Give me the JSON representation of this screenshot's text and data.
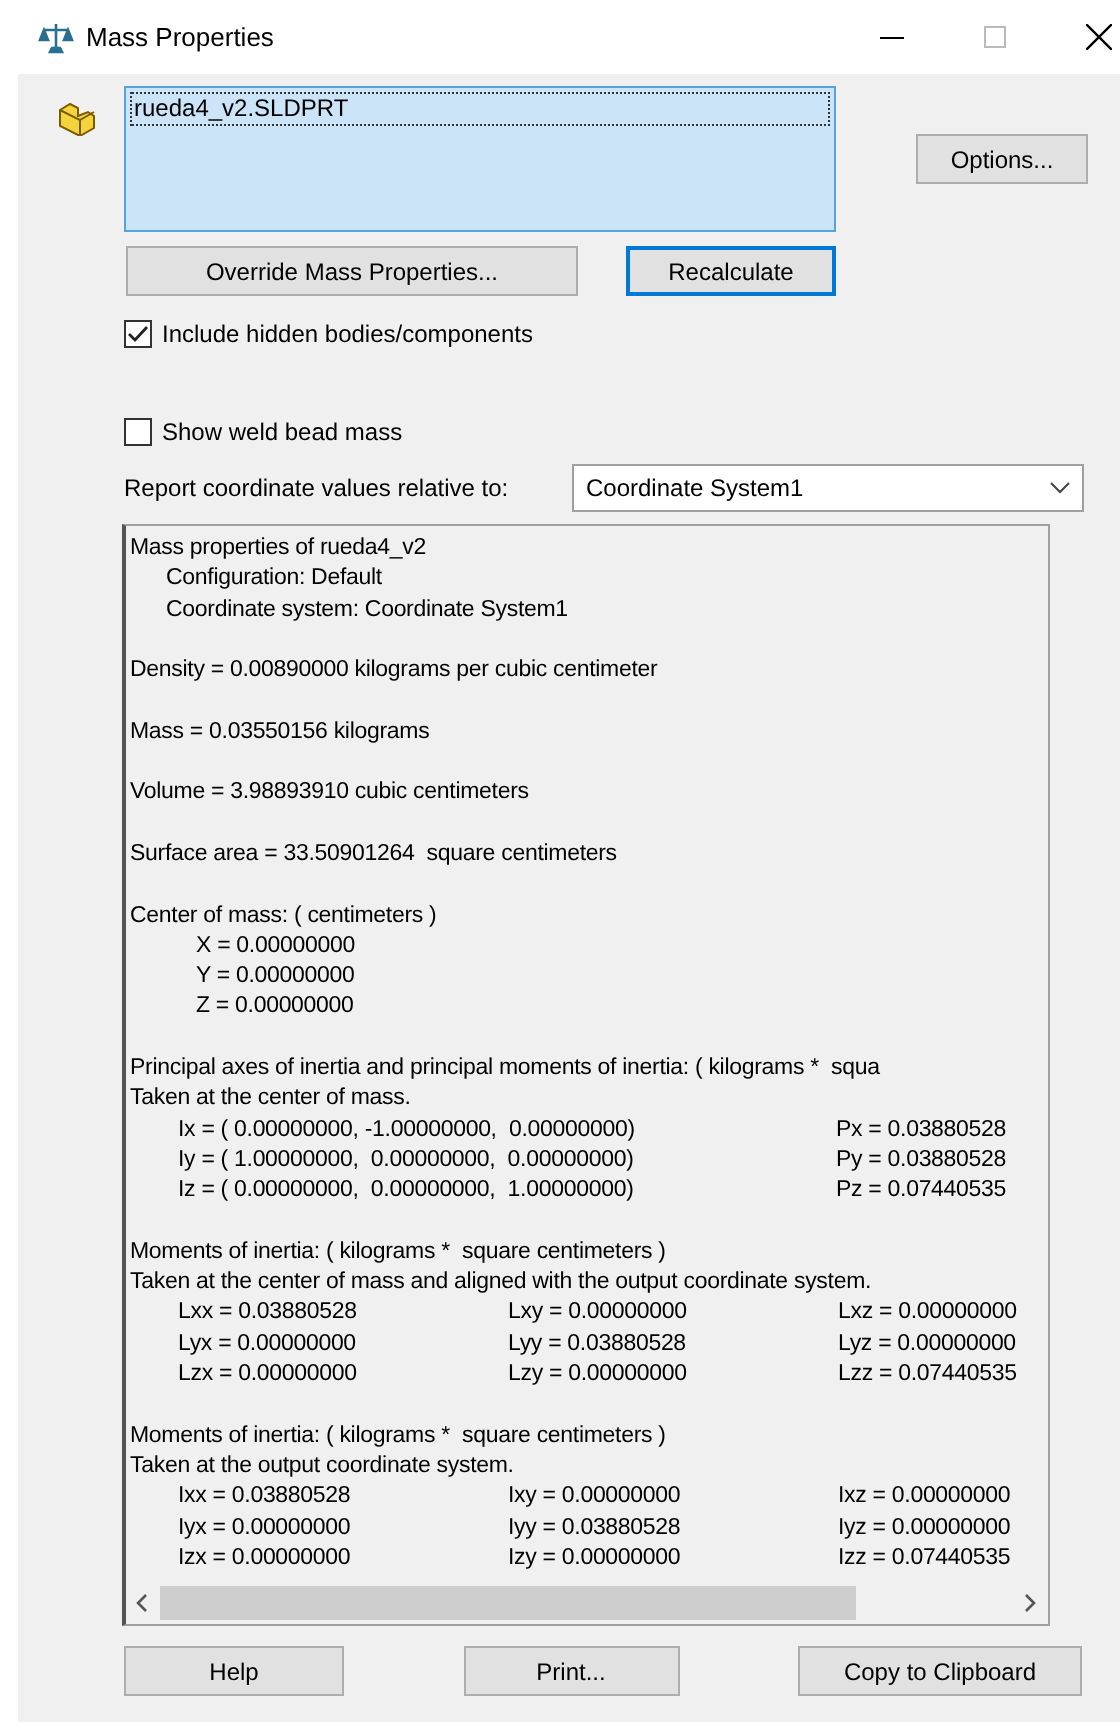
{
  "window": {
    "title": "Mass Properties"
  },
  "selection_list": {
    "items": [
      {
        "label": "rueda4_v2.SLDPRT",
        "selected": true
      }
    ]
  },
  "options_button": {
    "label": "Options..."
  },
  "action_buttons": [
    {
      "label": "Override Mass Properties...",
      "focused": false
    },
    {
      "label": "Recalculate",
      "focused": true
    }
  ],
  "include_hidden": {
    "label": "Include hidden bodies/components",
    "checked": true
  },
  "show_weld": {
    "label": "Show weld bead mass",
    "checked": false
  },
  "coordinate_system": {
    "label": "Report coordinate values relative to:",
    "value": "Coordinate System1"
  },
  "report": {
    "sections": [
      {
        "lines": [
          {
            "kind": "heading",
            "text": "Mass properties of rueda4_v2"
          },
          {
            "kind": "sub",
            "text": "Configuration: Default"
          },
          {
            "kind": "sub",
            "text": "Coordinate system: Coordinate System1"
          }
        ]
      },
      {
        "lines": [
          {
            "kind": "heading",
            "text": "Density = 0.00890000 kilograms per cubic centimeter"
          }
        ]
      },
      {
        "lines": [
          {
            "kind": "heading",
            "text": "Mass = 0.03550156 kilograms"
          }
        ]
      },
      {
        "lines": [
          {
            "kind": "heading",
            "text": "Volume = 3.98893910 cubic centimeters"
          }
        ]
      },
      {
        "lines": [
          {
            "kind": "heading",
            "text": "Surface area = 33.50901264  square centimeters"
          }
        ]
      },
      {
        "lines": [
          {
            "kind": "heading",
            "text": "Center of mass: ( centimeters )"
          },
          {
            "kind": "value",
            "text": "X = 0.00000000"
          },
          {
            "kind": "value",
            "text": "Y = 0.00000000"
          },
          {
            "kind": "value",
            "text": "Z = 0.00000000"
          }
        ]
      },
      {
        "lines": [
          {
            "kind": "heading",
            "text": "Principal axes of inertia and principal moments of inertia: ( kilograms *  squa"
          },
          {
            "kind": "heading",
            "text": "Taken at the center of mass."
          },
          {
            "kind": "row",
            "cells": [
              "Ix = ( 0.00000000, -1.00000000,  0.00000000)",
              "Px = 0.03880528"
            ]
          },
          {
            "kind": "row",
            "cells": [
              "Iy = ( 1.00000000,  0.00000000,  0.00000000)",
              "Py = 0.03880528"
            ]
          },
          {
            "kind": "row",
            "cells": [
              "Iz = ( 0.00000000,  0.00000000,  1.00000000)",
              "Pz = 0.07440535"
            ]
          }
        ]
      },
      {
        "lines": [
          {
            "kind": "heading",
            "text": "Moments of inertia: ( kilograms *  square centimeters )"
          },
          {
            "kind": "heading",
            "text": "Taken at the center of mass and aligned with the output coordinate system."
          },
          {
            "kind": "row",
            "cells": [
              "Lxx = 0.03880528",
              "Lxy = 0.00000000",
              "Lxz = 0.00000000"
            ]
          },
          {
            "kind": "row",
            "cells": [
              "Lyx = 0.00000000",
              "Lyy = 0.03880528",
              "Lyz = 0.00000000"
            ]
          },
          {
            "kind": "row",
            "cells": [
              "Lzx = 0.00000000",
              "Lzy = 0.00000000",
              "Lzz = 0.07440535"
            ]
          }
        ]
      },
      {
        "lines": [
          {
            "kind": "heading",
            "text": "Moments of inertia: ( kilograms *  square centimeters )"
          },
          {
            "kind": "heading",
            "text": "Taken at the output coordinate system."
          },
          {
            "kind": "row",
            "cells": [
              "Ixx = 0.03880528",
              "Ixy = 0.00000000",
              "Ixz = 0.00000000"
            ]
          },
          {
            "kind": "row",
            "cells": [
              "Iyx = 0.00000000",
              "Iyy = 0.03880528",
              "Iyz = 0.00000000"
            ]
          },
          {
            "kind": "row",
            "cells": [
              "Izx = 0.00000000",
              "Izy = 0.00000000",
              "Izz = 0.07440535"
            ]
          }
        ]
      }
    ]
  },
  "bottom_buttons": [
    {
      "label": "Help"
    },
    {
      "label": "Print..."
    },
    {
      "label": "Copy to Clipboard"
    }
  ]
}
